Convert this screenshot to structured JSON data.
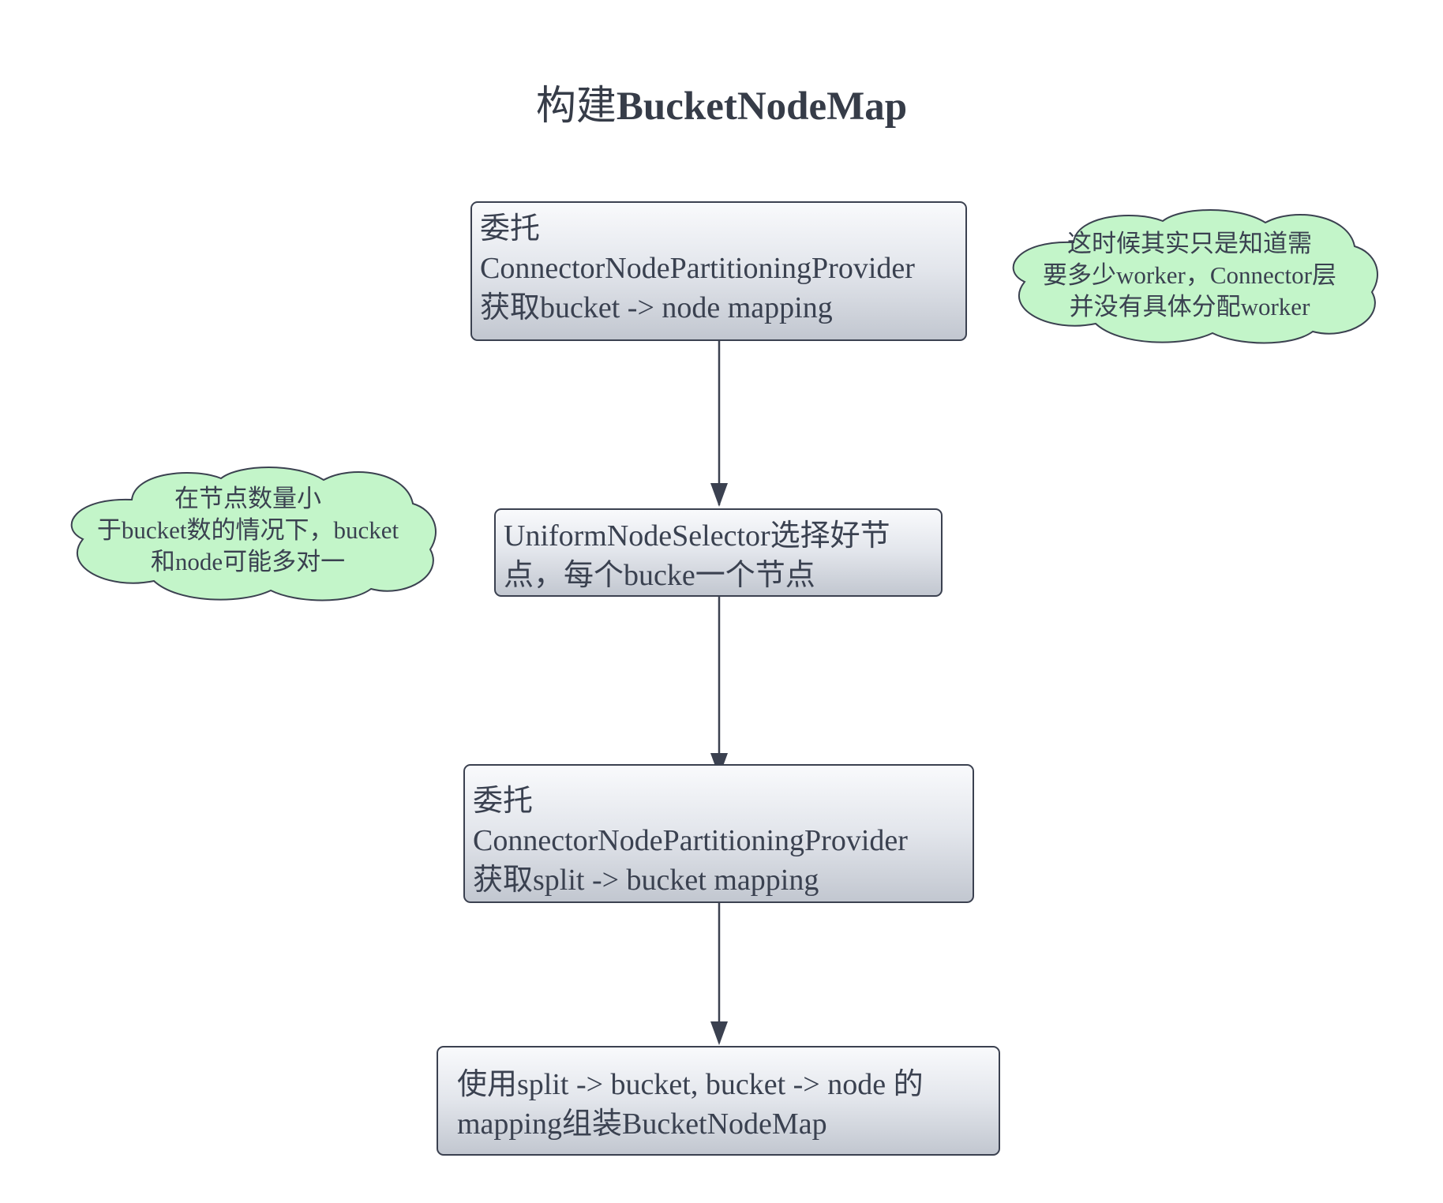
{
  "title": {
    "prefix": "构建",
    "bold": "BucketNodeMap"
  },
  "boxes": [
    {
      "id": "box-1",
      "lines": [
        "委托",
        "ConnectorNodePartitioningProvider",
        "获取bucket -> node mapping"
      ]
    },
    {
      "id": "box-2",
      "lines": [
        "UniformNodeSelector选择好节",
        "点，每个bucke一个节点"
      ]
    },
    {
      "id": "box-3",
      "lines": [
        "委托",
        "ConnectorNodePartitioningProvider",
        "获取split -> bucket mapping"
      ]
    },
    {
      "id": "box-4",
      "lines": [
        "使用split -> bucket, bucket -> node 的",
        "mapping组装BucketNodeMap"
      ]
    }
  ],
  "notes": [
    {
      "id": "cloud-1",
      "lines": [
        "这时候其实只是知道需",
        "要多少worker，Connector层",
        "并没有具体分配worker"
      ]
    },
    {
      "id": "cloud-2",
      "lines": [
        "在节点数量小",
        "于bucket数的情况下，bucket",
        "和node可能多对一"
      ]
    }
  ],
  "colors": {
    "box_border": "#3b4150",
    "box_gradient_top": "#f9fafc",
    "box_gradient_bottom": "#c2c7d0",
    "cloud_fill": "#c3f5c9",
    "cloud_stroke": "#3b4150",
    "connector": "#3b4150",
    "text": "#3a4150"
  },
  "icons": {
    "arrowhead": "arrowhead-down-icon",
    "cloud": "cloud-shape-icon"
  }
}
